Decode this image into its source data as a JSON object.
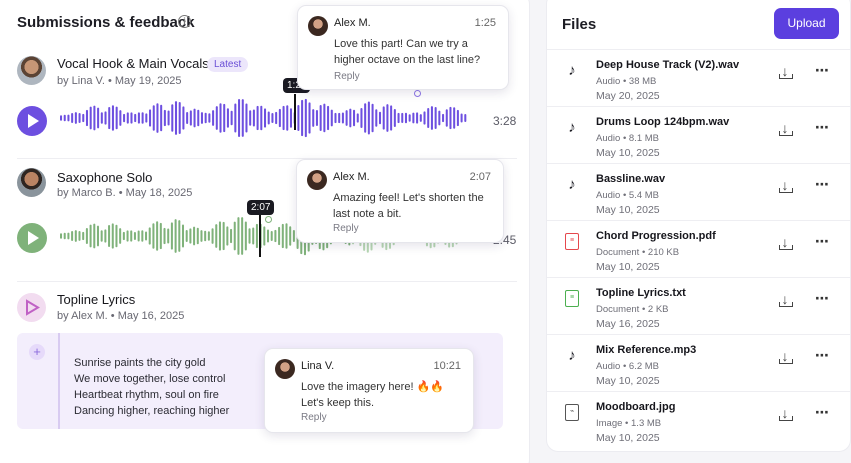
{
  "submissions": {
    "title": "Submissions & feedback",
    "items": [
      {
        "title": "Vocal Hook & Main Vocals",
        "badge": "Latest",
        "author": "by Lina V.",
        "date": "May 19, 2025",
        "duration": "3:28",
        "marker": "1:25",
        "comment": {
          "name": "Alex M.",
          "time": "1:25",
          "text": "Love this part! Can we try a higher octave on the last line?",
          "reply": "Reply"
        }
      },
      {
        "title": "Saxophone Solo",
        "author": "by Marco B.",
        "date": "May 18, 2025",
        "duration": "2:45",
        "marker": "2:07",
        "comment": {
          "name": "Alex M.",
          "time": "2:07",
          "text": "Amazing feel! Let's shorten the last note a bit.",
          "reply": "Reply"
        }
      },
      {
        "title": "Topline Lyrics",
        "author": "by Alex M.",
        "date": "May 16, 2025",
        "lyrics": [
          "Sunrise paints the city gold",
          "We move together, lose control",
          "Heartbeat rhythm, soul on fire",
          "Dancing higher, reaching higher"
        ],
        "comment": {
          "name": "Lina V.",
          "time": "10:21",
          "text": "Love the imagery here! 🔥🔥 Let's keep this.",
          "reply": "Reply"
        }
      }
    ]
  },
  "files": {
    "title": "Files",
    "upload_label": "Upload",
    "items": [
      {
        "name": "Deep House Track (V2).wav",
        "type": "Audio",
        "size": "38 MB",
        "date": "May 20, 2025",
        "icon": "music-note-icon"
      },
      {
        "name": "Drums Loop 124bpm.wav",
        "type": "Audio",
        "size": "8.1 MB",
        "date": "May 10, 2025",
        "icon": "music-note-icon"
      },
      {
        "name": "Bassline.wav",
        "type": "Audio",
        "size": "5.4 MB",
        "date": "May 10, 2025",
        "icon": "music-note-icon"
      },
      {
        "name": "Chord Progression.pdf",
        "type": "Document",
        "size": "210 KB",
        "date": "May 10, 2025",
        "icon": "pdf-icon"
      },
      {
        "name": "Topline Lyrics.txt",
        "type": "Document",
        "size": "2 KB",
        "date": "May 16, 2025",
        "icon": "text-doc-icon"
      },
      {
        "name": "Mix Reference.mp3",
        "type": "Audio",
        "size": "6.2 MB",
        "date": "May 10, 2025",
        "icon": "music-note-icon"
      },
      {
        "name": "Moodboard.jpg",
        "type": "Image",
        "size": "1.3 MB",
        "date": "May 10, 2025",
        "icon": "image-icon"
      }
    ]
  },
  "colors": {
    "accent": "#5b3fdf",
    "wave_purple": "#6d4fe0",
    "wave_green": "#7fb27a",
    "pdf_red": "#e5484d",
    "txt_green": "#4caf50"
  }
}
